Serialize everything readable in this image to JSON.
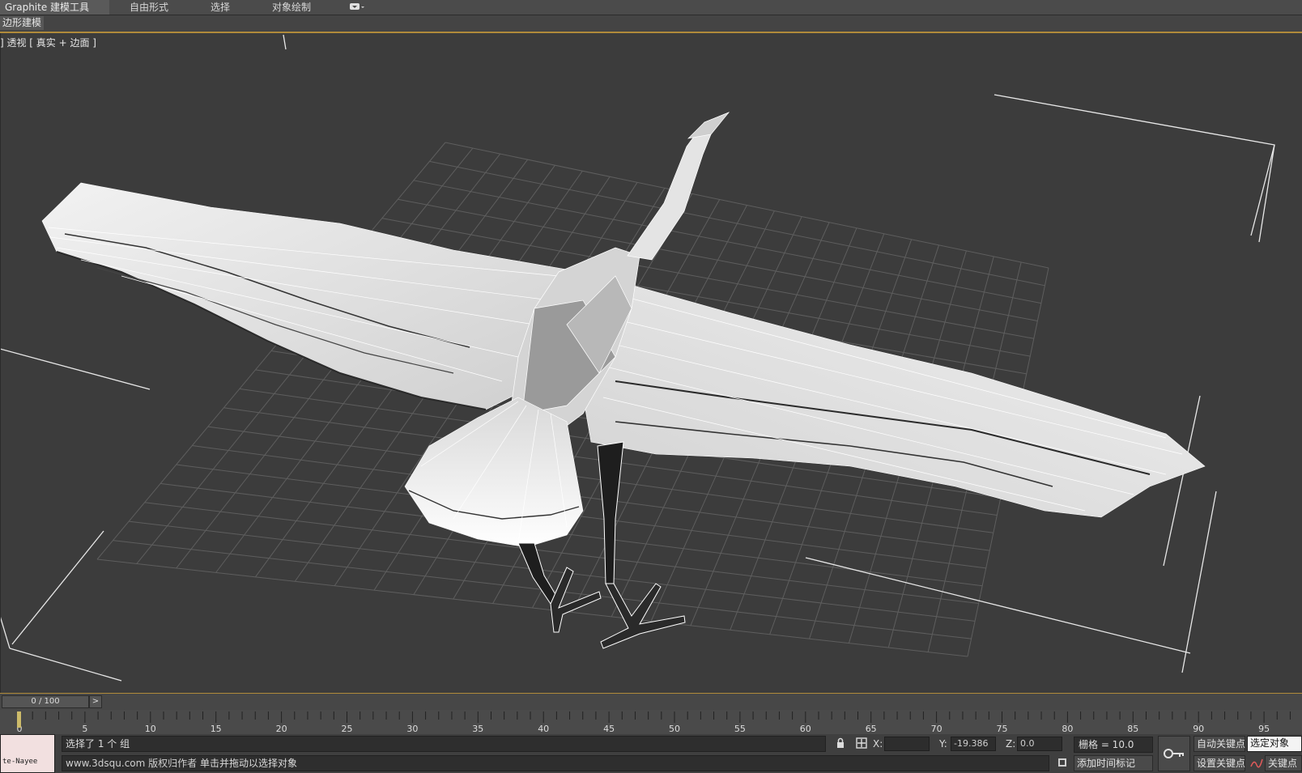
{
  "ribbon": {
    "tabs": [
      "Graphite 建模工具",
      "自由形式",
      "选择",
      "对象绘制"
    ],
    "more_icon": "dropdown-chevron-icon",
    "panel_label": "边形建模"
  },
  "viewport": {
    "label": "] 透视 [ 真实 + 边面 ]"
  },
  "timeline": {
    "frame_display": "0 / 100",
    "next_label": ">",
    "current_frame": 0,
    "range": [
      0,
      100
    ],
    "tick_labels": [
      "0",
      "5",
      "10",
      "15",
      "20",
      "25",
      "30",
      "35",
      "40",
      "45",
      "50",
      "55",
      "60",
      "65",
      "70",
      "75",
      "80",
      "85",
      "90",
      "95"
    ]
  },
  "status": {
    "swatch_text": "te-Nayee",
    "selection_text": "选择了 1 个 组",
    "prompt_text": "单击并拖动以选择对象",
    "overlay_text": "www.3dsqu.com 版权归作者",
    "x_label": "X:",
    "x_value": "",
    "y_label": "Y:",
    "y_value": "-19.386",
    "z_label": "Z:",
    "z_value": "0.0",
    "grid_text": "栅格 = 10.0",
    "add_time_tag": "添加时间标记",
    "auto_key": "自动关键点",
    "selected_object": "选定对象",
    "set_key": "设置关键点",
    "key_filters": "关键点",
    "lock_icon": "lock-icon",
    "absolute_icon": "absolute-mode-icon",
    "key_icon": "key-icon",
    "curve_icon": "curve-icon",
    "accent": "#b08a3a"
  }
}
